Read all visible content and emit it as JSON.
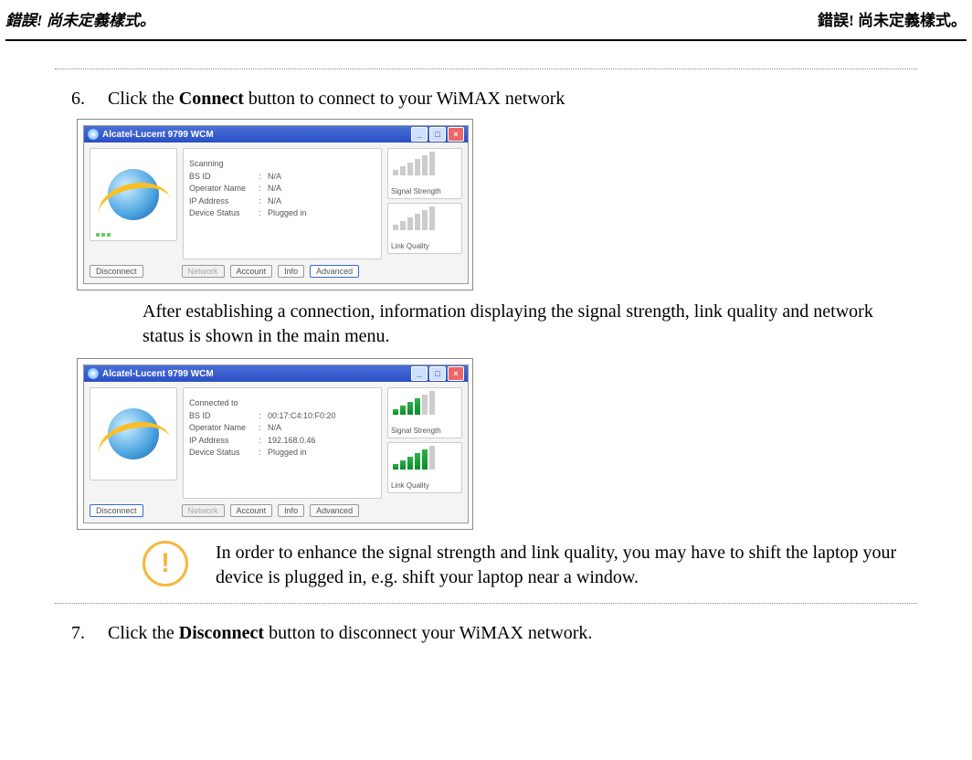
{
  "header": {
    "left": "錯誤! 尚未定義樣式。",
    "right": "錯誤! 尚未定義樣式。"
  },
  "step6": {
    "num": "6.",
    "pre": "Click the ",
    "bold": "Connect",
    "post": " button to connect to your WiMAX network"
  },
  "explain6": "After establishing a connection, information displaying the signal strength, link quality and network status is shown in the main menu.",
  "tip": "In order to enhance the signal strength and link quality, you may have to shift the laptop your device is plugged in, e.g. shift your laptop near a window.",
  "step7": {
    "num": "7.",
    "pre": "Click the ",
    "bold": "Disconnect",
    "post": " button to disconnect your WiMAX network."
  },
  "app": {
    "title": "Alcatel-Lucent 9799 WCM",
    "buttons": {
      "disconnect": "Disconnect",
      "network": "Network",
      "account": "Account",
      "info": "Info",
      "advanced": "Advanced"
    },
    "meters": {
      "signal": "Signal Strength",
      "link": "Link Quality"
    },
    "labels": {
      "scanning": "Scanning",
      "connected": "Connected to",
      "bsid": "BS ID",
      "operator": "Operator Name",
      "ip": "IP Address",
      "device": "Device Status"
    },
    "shot1": {
      "status": "Scanning",
      "bsid": "N/A",
      "operator": "N/A",
      "ip": "N/A",
      "device": "Plugged in",
      "signal_bars_on": 0,
      "link_bars_on": 0
    },
    "shot2": {
      "status": "Connected to",
      "bsid": "00:17:C4:10:F0:20",
      "operator": "N/A",
      "ip": "192.168.0.46",
      "device": "Plugged in",
      "signal_bars_on": 4,
      "link_bars_on": 5
    }
  }
}
